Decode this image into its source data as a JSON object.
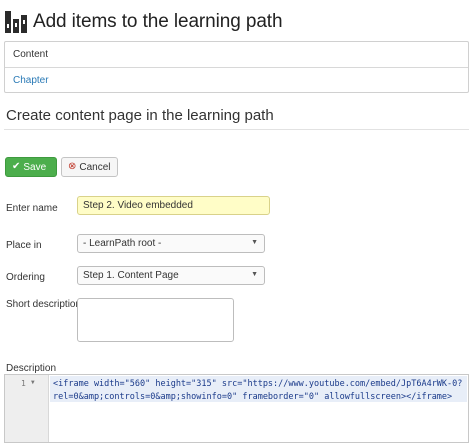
{
  "header": {
    "title": "Add items to the learning path",
    "logo_icon": "learnpath-logo-icon"
  },
  "nav_list": [
    {
      "label": "Content"
    },
    {
      "label": "Chapter"
    }
  ],
  "section": {
    "title": "Create content page in the learning path"
  },
  "buttons": {
    "save_label": "Save",
    "cancel_label": "Cancel"
  },
  "form": {
    "name_label": "Enter name",
    "name_value": "Step 2. Video embedded",
    "place_label": "Place in",
    "place_value": "- LearnPath root -",
    "ordering_label": "Ordering",
    "ordering_value": "Step 1. Content Page",
    "short_desc_label": "Short description",
    "short_desc_value": "",
    "description_label": "Description"
  },
  "editor": {
    "line_number": "1",
    "line1": "<iframe width=\"560\" height=\"315\" src=\"https://www.youtube.com/embed/JpT6A4rWK-0?",
    "line2": "rel=0&amp;controls=0&amp;showinfo=0\" frameborder=\"0\" allowfullscreen></iframe>"
  },
  "colors": {
    "save_bg": "#4cae4c",
    "link": "#2a7ab6",
    "highlight_input": "#fffdc7",
    "editor_line": "#e8eef8"
  }
}
